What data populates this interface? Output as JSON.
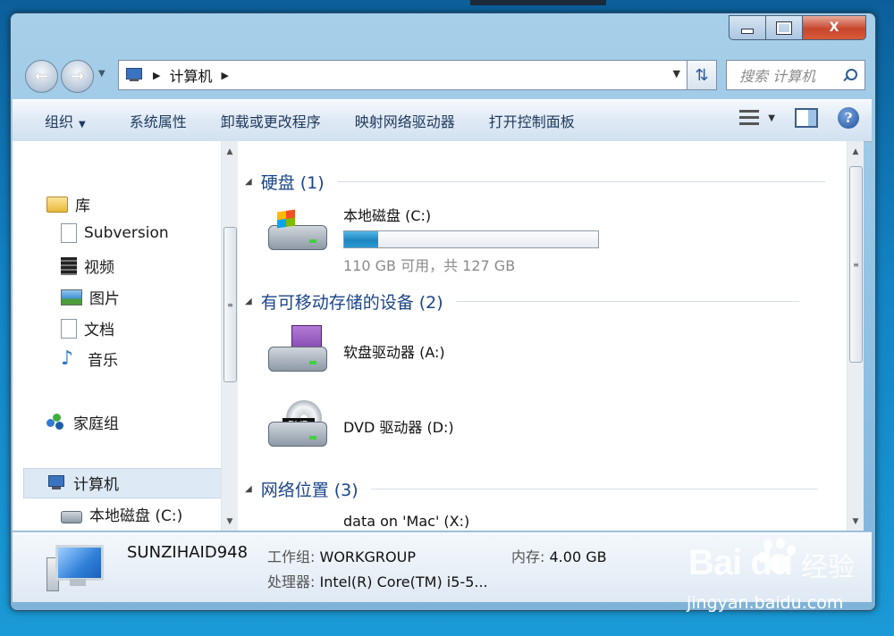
{
  "window": {
    "caption": {
      "minimize": "",
      "maximize": "",
      "close": "X"
    }
  },
  "address": {
    "crumb": "计算机",
    "search_placeholder": "搜索 计算机"
  },
  "toolbar": {
    "organize": "组织",
    "system_properties": "系统属性",
    "uninstall": "卸载或更改程序",
    "map_drive": "映射网络驱动器",
    "control_panel": "打开控制面板",
    "help": "?"
  },
  "sidebar": {
    "libraries": "库",
    "items": [
      "Subversion",
      "视频",
      "图片",
      "文档",
      "音乐"
    ],
    "homegroup": "家庭组",
    "computer": "计算机",
    "local_disk": "本地磁盘 (C:)"
  },
  "groups": {
    "hdd": {
      "title": "硬盘 (1)",
      "drive_name": "本地磁盘 (C:)",
      "drive_info": "110 GB 可用，共 127 GB",
      "used_fraction": 0.134
    },
    "removable": {
      "title": "有可移动存储的设备 (2)",
      "floppy": "软盘驱动器 (A:)",
      "dvd": "DVD 驱动器 (D:)",
      "dvd_badge": "DVD"
    },
    "network": {
      "title": "网络位置 (3)",
      "item": "data on 'Mac' (X:)"
    }
  },
  "details": {
    "name": "SUNZIHAID948",
    "workgroup_label": "工作组:",
    "workgroup": "WORKGROUP",
    "memory_label": "内存:",
    "memory": "4.00 GB",
    "cpu_label": "处理器:",
    "cpu": "Intel(R) Core(TM) i5-5..."
  },
  "watermark": {
    "logo": "Bai du",
    "cn": "经验",
    "url": "jingyan.baidu.com"
  },
  "colors": {
    "group_title": "#1b4587",
    "progress": "#1d86c2",
    "desktop": "#1384c4"
  }
}
